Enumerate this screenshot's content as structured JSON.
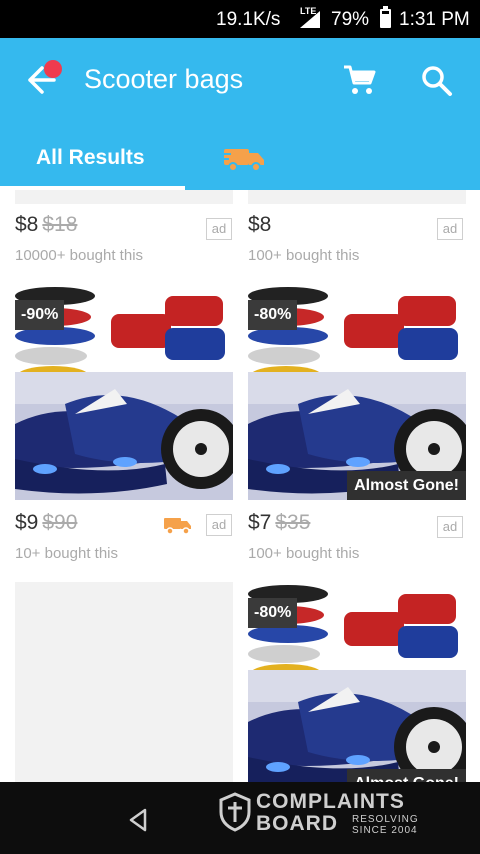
{
  "status": {
    "net": "19.1K/s",
    "lte": "LTE",
    "battery": "79%",
    "time": "1:31 PM"
  },
  "header": {
    "title": "Scooter bags"
  },
  "tabs": {
    "all": "All Results"
  },
  "products": [
    {
      "price": "$8",
      "old_price": "$18",
      "ad": "ad",
      "bought": "10000+ bought this"
    },
    {
      "price": "$8",
      "old_price": "",
      "ad": "ad",
      "bought": "100+ bought this"
    },
    {
      "price": "$9",
      "old_price": "$90",
      "ad": "ad",
      "bought": "10+ bought this",
      "discount": "-90%"
    },
    {
      "price": "$7",
      "old_price": "$35",
      "ad": "ad",
      "bought": "100+ bought this",
      "discount": "-80%",
      "badge": "Almost Gone!"
    },
    {
      "discount": "-80%",
      "badge": "Almost Gone!"
    }
  ],
  "watermark": {
    "line1": "COMPLAINTS",
    "line2": "BOARD",
    "tag1": "RESOLVING",
    "tag2": "SINCE 2004"
  },
  "colors": {
    "header": "#35b9ee",
    "dot": "#ef3b4e",
    "ship": "#f5a14a"
  }
}
